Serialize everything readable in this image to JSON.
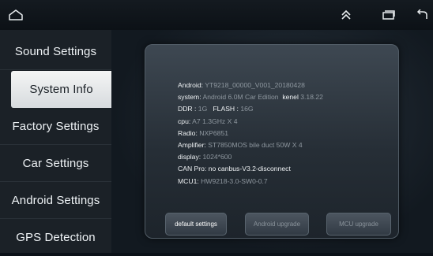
{
  "status_bar": {
    "icons": [
      "home-icon",
      "double-chevron-up-icon",
      "recent-apps-icon",
      "back-icon"
    ]
  },
  "sidebar": {
    "items": [
      {
        "label": "Sound Settings",
        "active": false
      },
      {
        "label": "System Info",
        "active": true
      },
      {
        "label": "Factory Settings",
        "active": false
      },
      {
        "label": "Car Settings",
        "active": false
      },
      {
        "label": "Android Settings",
        "active": false
      },
      {
        "label": "GPS Detection",
        "active": false
      }
    ]
  },
  "info": {
    "android_label": "Android:",
    "android_value": "YT9218_00000_V001_20180428",
    "system_label": "system:",
    "system_value": "Android 6.0M Car Edition",
    "kenel_label": "kenel",
    "kenel_value": "3.18.22",
    "ddr_label": "DDR :",
    "ddr_value": "1G",
    "flash_label": "FLASH :",
    "flash_value": "16G",
    "cpu_label": "cpu:",
    "cpu_value": "A7 1.3GHz X 4",
    "radio_label": "Radio:",
    "radio_value": "NXP6851",
    "amplifier_label": "Amplifier:",
    "amplifier_value": "ST7850MOS bile duct 50W X 4",
    "display_label": "display:",
    "display_value": "1024*600",
    "canpro_label": "CAN Pro:",
    "canpro_value": "no canbus-V3.2-disconnect",
    "mcu1_label": "MCU1:",
    "mcu1_value": "HW9218-3.0-SW0-0.7"
  },
  "buttons": {
    "default": "default settings",
    "android_upgrade": "Android upgrade",
    "mcu_upgrade": "MCU upgrade"
  },
  "colors": {
    "background": "#0b1118",
    "sidebar": "#1b2127",
    "active_item": "#e8eaeb",
    "label_text": "#eef1f3",
    "value_text": "#8e979f"
  }
}
